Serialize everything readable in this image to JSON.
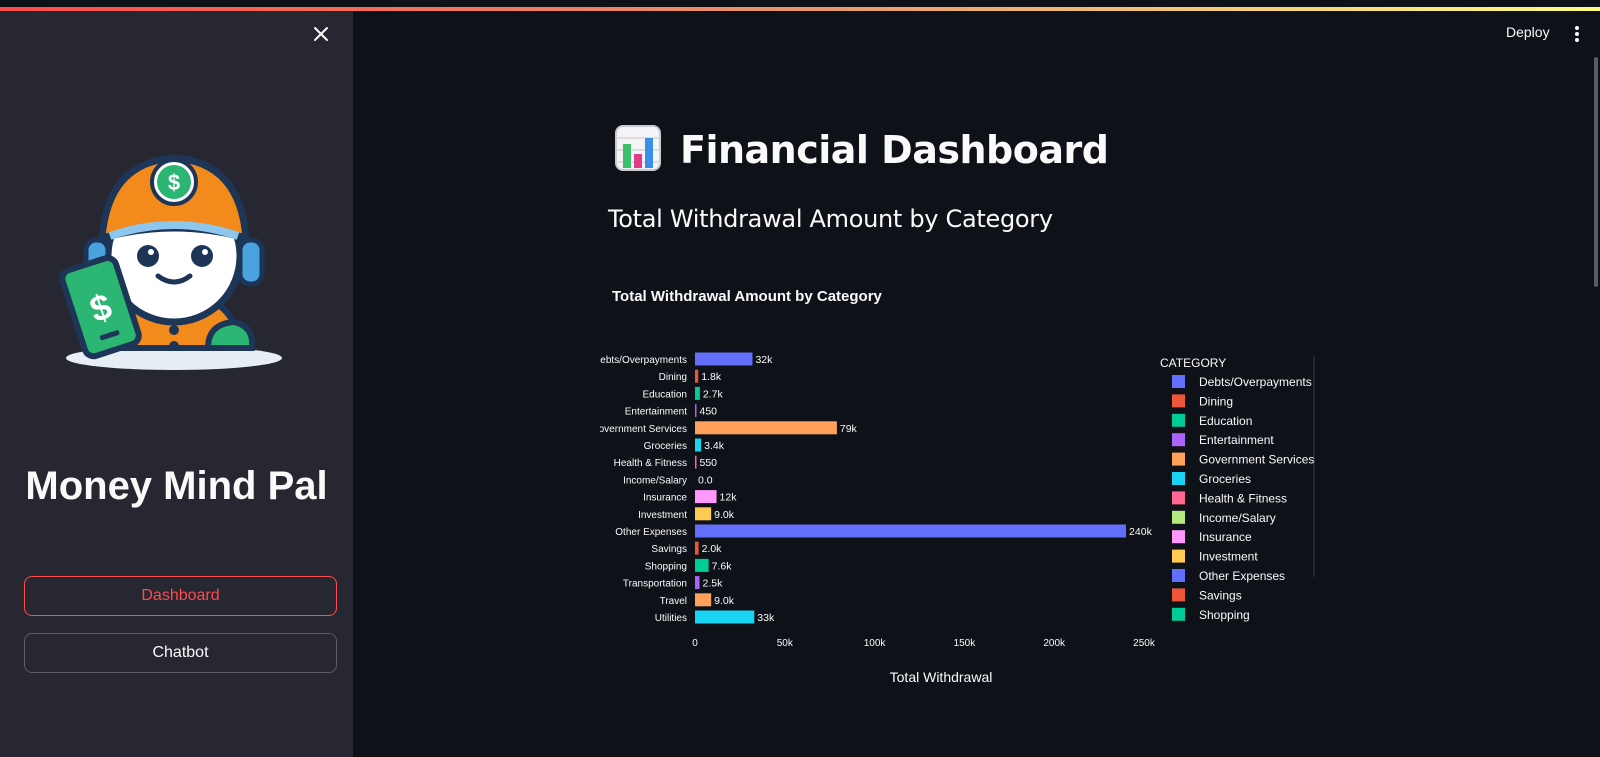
{
  "sidebar": {
    "app_name": "Money Mind Pal",
    "nav": [
      {
        "label": "Dashboard",
        "active": true
      },
      {
        "label": "Chatbot",
        "active": false
      }
    ],
    "close_icon": "close-icon",
    "logo_icon": "robot-money-mascot-icon"
  },
  "header": {
    "deploy_label": "Deploy",
    "menu_icon": "kebab-menu-icon"
  },
  "main": {
    "title": "Financial Dashboard",
    "title_icon": "bar-chart-icon",
    "section_title": "Total Withdrawal Amount by Category"
  },
  "chart_data": {
    "type": "bar",
    "orientation": "horizontal",
    "title": "Total Withdrawal Amount by Category",
    "xlabel": "Total Withdrawal",
    "ylabel": "",
    "xlim": [
      0,
      255000
    ],
    "x_ticks": [
      0,
      50000,
      100000,
      150000,
      200000,
      250000
    ],
    "x_tick_labels": [
      "0",
      "50k",
      "100k",
      "150k",
      "200k",
      "250k"
    ],
    "grid": false,
    "legend_title": "CATEGORY",
    "legend_position": "right",
    "categories": [
      "Debts/Overpayments",
      "Dining",
      "Education",
      "Entertainment",
      "Government Services",
      "Groceries",
      "Health & Fitness",
      "Income/Salary",
      "Insurance",
      "Investment",
      "Other Expenses",
      "Savings",
      "Shopping",
      "Transportation",
      "Travel",
      "Utilities"
    ],
    "values": [
      32000,
      1800,
      2700,
      450,
      79000,
      3400,
      550,
      0,
      12000,
      9000,
      240000,
      2000,
      7600,
      2500,
      9000,
      33000
    ],
    "data_labels": [
      "32k",
      "1.8k",
      "2.7k",
      "450",
      "79k",
      "3.4k",
      "550",
      "0.0",
      "12k",
      "9.0k",
      "240k",
      "2.0k",
      "7.6k",
      "2.5k",
      "9.0k",
      "33k"
    ],
    "colors": [
      "#636efa",
      "#ef553b",
      "#00cc96",
      "#ab63fa",
      "#ffa15a",
      "#19d3f3",
      "#ff6692",
      "#b6e880",
      "#ff97ff",
      "#fecb52",
      "#636efa",
      "#ef553b",
      "#00cc96",
      "#ab63fa",
      "#ffa15a",
      "#19d3f3"
    ],
    "legend_entries": [
      "Debts/Overpayments",
      "Dining",
      "Education",
      "Entertainment",
      "Government Services",
      "Groceries",
      "Health & Fitness",
      "Income/Salary",
      "Insurance",
      "Investment",
      "Other Expenses",
      "Savings",
      "Shopping"
    ]
  }
}
